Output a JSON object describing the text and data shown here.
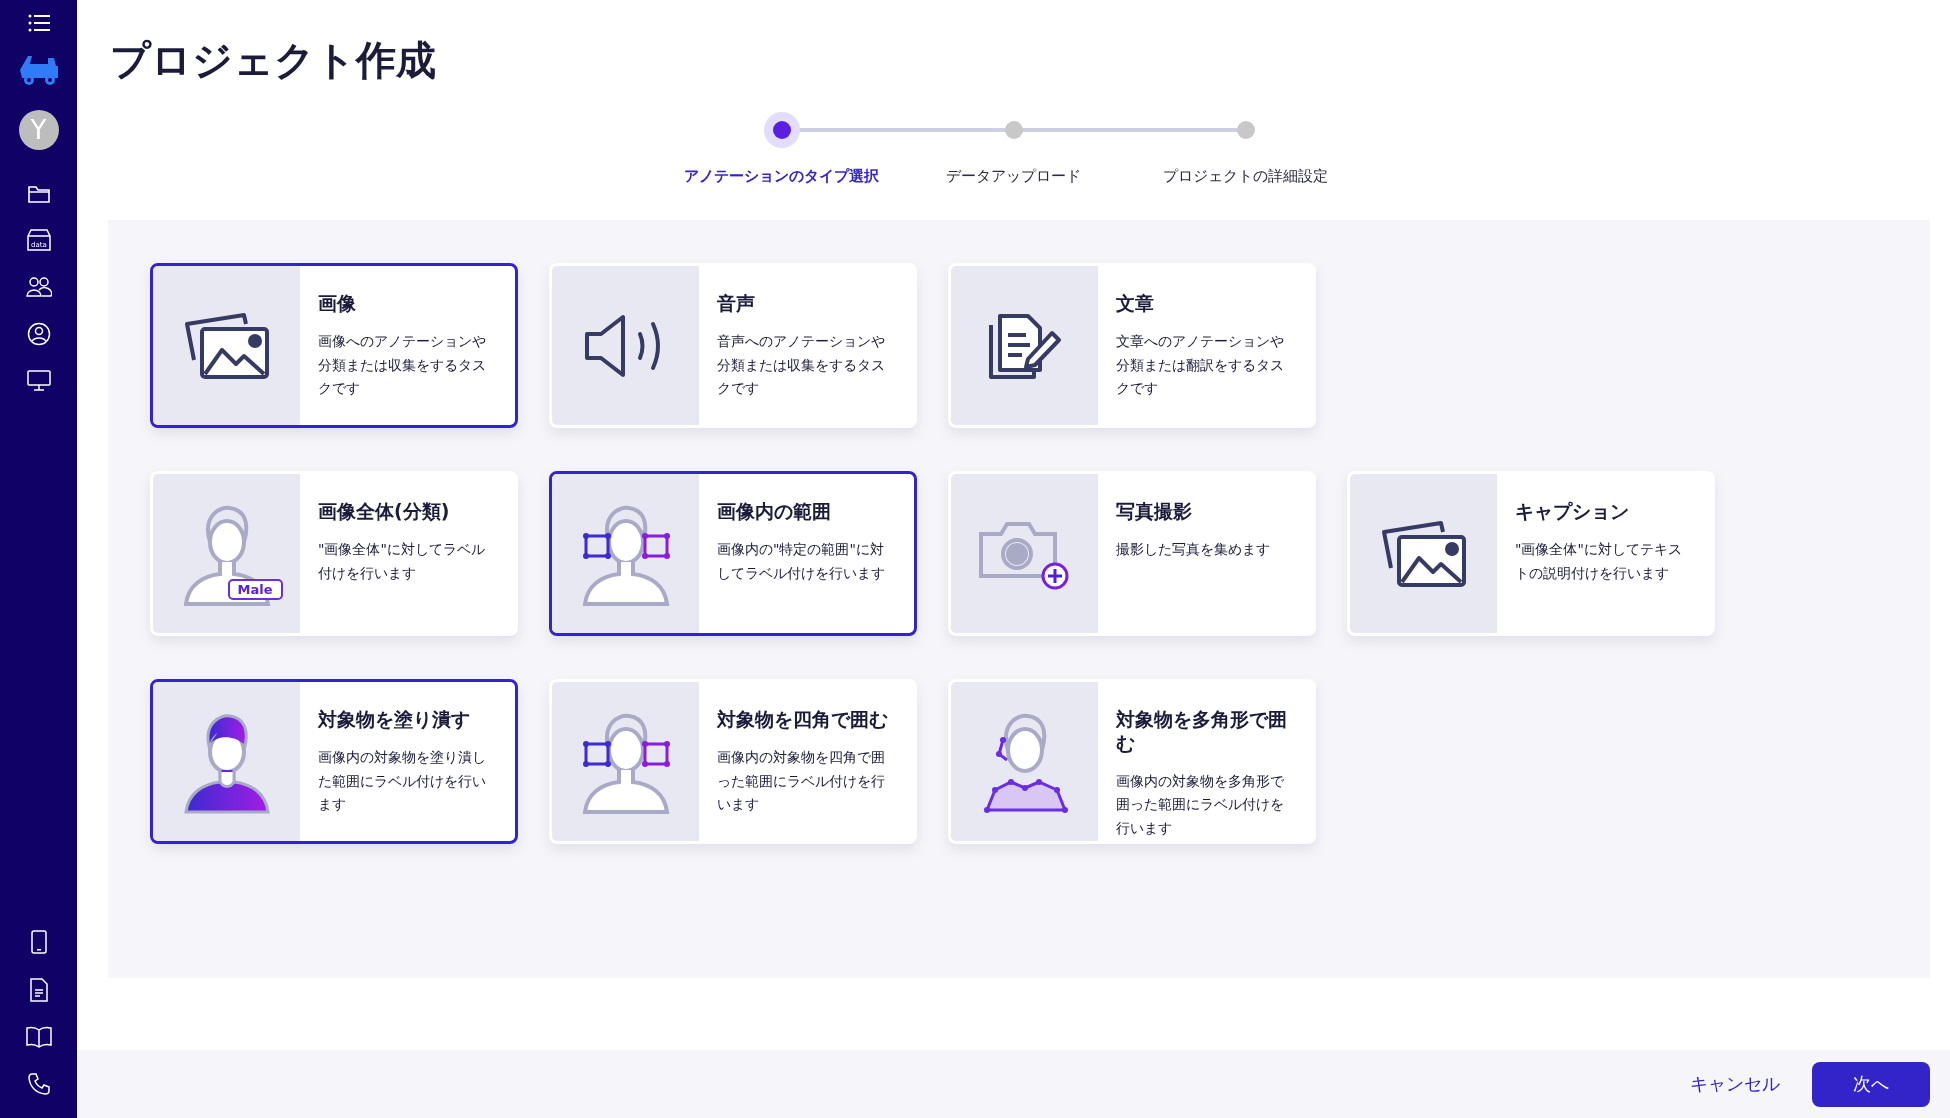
{
  "sidebar": {
    "avatar": "Y",
    "data_icon_text": "data"
  },
  "title": "プロジェクト作成",
  "steps": [
    {
      "label": "アノテーションのタイプ選択",
      "selected": true
    },
    {
      "label": "データアップロード",
      "selected": false
    },
    {
      "label": "プロジェクトの詳細設定",
      "selected": false
    }
  ],
  "cards": [
    {
      "kind": "images",
      "title": "画像",
      "description": "画像へのアノテーションや分類または収集をするタスクです",
      "selected": true
    },
    {
      "kind": "speaker",
      "title": "音声",
      "description": "音声へのアノテーションや分類または収集をするタスクです",
      "selected": false
    },
    {
      "kind": "document",
      "title": "文章",
      "description": "文章へのアノテーションや分類または翻訳をするタスクです",
      "selected": false
    },
    {
      "kind": "gap"
    },
    {
      "kind": "person-tag",
      "title": "画像全体(分類)",
      "description": "\"画像全体\"に対してラベル付けを行います",
      "tag": "Male",
      "selected": false
    },
    {
      "kind": "person-boxes",
      "title": "画像内の範囲",
      "description": "画像内の\"特定の範囲\"に対してラベル付けを行います",
      "selected": true
    },
    {
      "kind": "camera",
      "title": "写真撮影",
      "description": "撮影した写真を集めます",
      "selected": false
    },
    {
      "kind": "images",
      "title": "キャプション",
      "description": "\"画像全体\"に対してテキストの説明付けを行います",
      "selected": false
    },
    {
      "kind": "person-fill",
      "title": "対象物を塗り潰す",
      "description": "画像内の対象物を塗り潰した範囲にラベル付けを行います",
      "selected": true
    },
    {
      "kind": "person-boxes",
      "title": "対象物を四角で囲む",
      "description": "画像内の対象物を四角で囲った範囲にラベル付けを行います",
      "selected": false
    },
    {
      "kind": "person-polygon",
      "title": "対象物を多角形で囲む",
      "description": "画像内の対象物を多角形で囲った範囲にラベル付けを行います",
      "selected": false
    }
  ],
  "footer": {
    "cancel": "キャンセル",
    "next": "次へ"
  }
}
